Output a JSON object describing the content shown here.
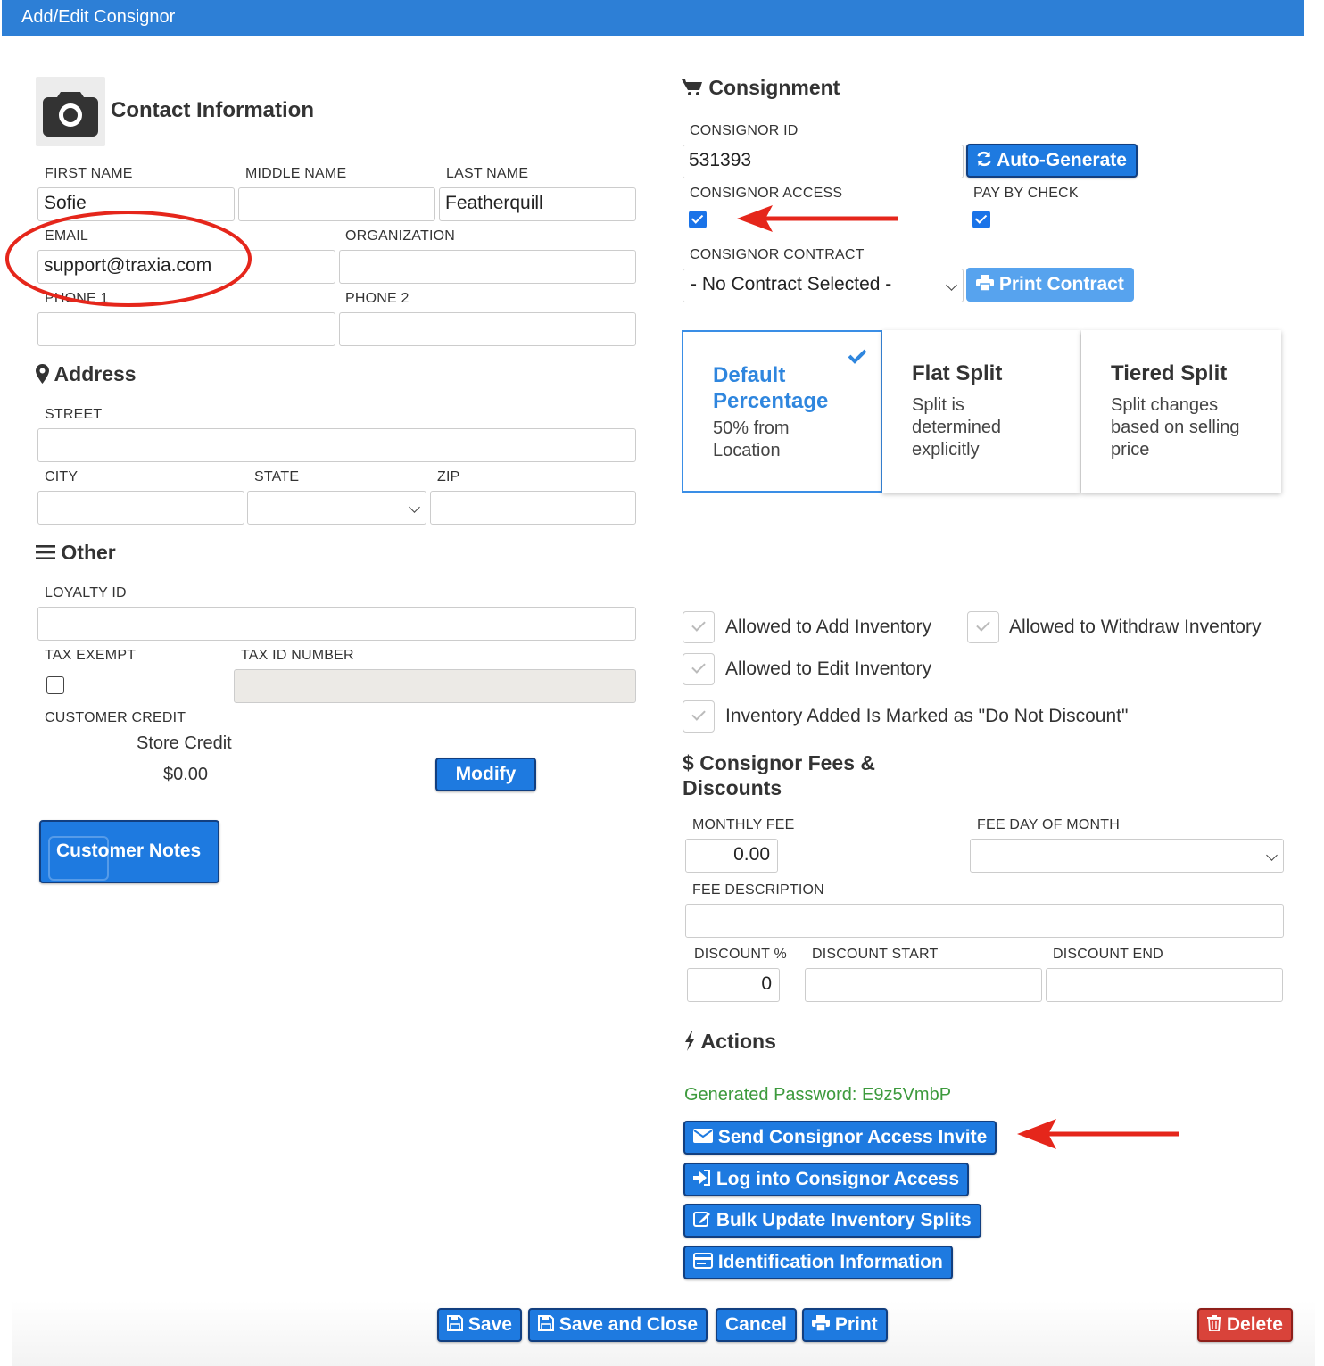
{
  "window": {
    "title": "Add/Edit Consignor"
  },
  "contact": {
    "heading": "Contact Information",
    "first_name_label": "FIRST NAME",
    "first_name": "Sofie",
    "middle_name_label": "MIDDLE NAME",
    "middle_name": "",
    "last_name_label": "LAST NAME",
    "last_name": "Featherquill",
    "email_label": "EMAIL",
    "email": "support@traxia.com",
    "organization_label": "ORGANIZATION",
    "organization": "",
    "phone1_label": "PHONE 1",
    "phone1": "",
    "phone2_label": "PHONE 2",
    "phone2": ""
  },
  "address": {
    "heading": "Address",
    "street_label": "STREET",
    "street": "",
    "city_label": "CITY",
    "city": "",
    "state_label": "STATE",
    "state": "",
    "zip_label": "ZIP",
    "zip": ""
  },
  "other": {
    "heading": "Other",
    "loyalty_label": "LOYALTY ID",
    "loyalty": "",
    "tax_exempt_label": "TAX EXEMPT",
    "tax_exempt": false,
    "tax_id_label": "TAX ID NUMBER",
    "tax_id": "",
    "customer_credit_label": "CUSTOMER CREDIT",
    "store_credit_label": "Store Credit",
    "store_credit_value": "$0.00",
    "modify_label": "Modify",
    "customer_notes_label": "Customer Notes"
  },
  "consignment": {
    "heading": "Consignment",
    "id_label": "CONSIGNOR ID",
    "id": "531393",
    "auto_generate_label": "Auto-Generate",
    "access_label": "CONSIGNOR ACCESS",
    "access": true,
    "pay_by_check_label": "PAY BY CHECK",
    "pay_by_check": true,
    "contract_label": "CONSIGNOR CONTRACT",
    "contract": "- No Contract Selected -",
    "print_contract_label": "Print Contract",
    "split_options": [
      {
        "title": "Default Percentage",
        "desc": "50% from Location",
        "selected": true
      },
      {
        "title": "Flat Split",
        "desc": "Split is determined explicitly",
        "selected": false
      },
      {
        "title": "Tiered Split",
        "desc": "Split changes based on selling price",
        "selected": false
      }
    ],
    "permissions": {
      "add": "Allowed to Add Inventory",
      "withdraw": "Allowed to Withdraw Inventory",
      "edit": "Allowed to Edit Inventory",
      "no_discount": "Inventory Added Is Marked as \"Do Not Discount\""
    }
  },
  "fees": {
    "heading_line1": "Consignor Fees &",
    "heading_line2": "Discounts",
    "monthly_fee_label": "MONTHLY FEE",
    "monthly_fee": "0.00",
    "fee_day_label": "FEE DAY OF MONTH",
    "fee_day": "",
    "fee_desc_label": "FEE DESCRIPTION",
    "fee_desc": "",
    "discount_label": "DISCOUNT %",
    "discount": "0",
    "discount_start_label": "DISCOUNT START",
    "discount_start": "",
    "discount_end_label": "DISCOUNT END",
    "discount_end": ""
  },
  "actions": {
    "heading": "Actions",
    "generated_password": "Generated Password: E9z5VmbP",
    "send_invite": "Send Consignor Access Invite",
    "log_into": "Log into Consignor Access",
    "bulk_update": "Bulk Update Inventory Splits",
    "identification": "Identification Information"
  },
  "footer": {
    "save": "Save",
    "save_close": "Save and Close",
    "cancel": "Cancel",
    "print": "Print",
    "delete": "Delete"
  },
  "colors": {
    "accent": "#1e7ae0",
    "titlebar": "#2d7fd6",
    "danger": "#d9433a",
    "annotation": "#e5261b",
    "success": "#3d9a3d"
  },
  "icons": [
    "camera-icon",
    "cart-icon",
    "refresh-icon",
    "printer-icon",
    "map-marker-icon",
    "menu-icon",
    "dollar-icon",
    "bolt-icon",
    "envelope-icon",
    "sign-in-icon",
    "edit-icon",
    "id-card-icon",
    "floppy-icon",
    "trash-icon",
    "check-icon"
  ]
}
